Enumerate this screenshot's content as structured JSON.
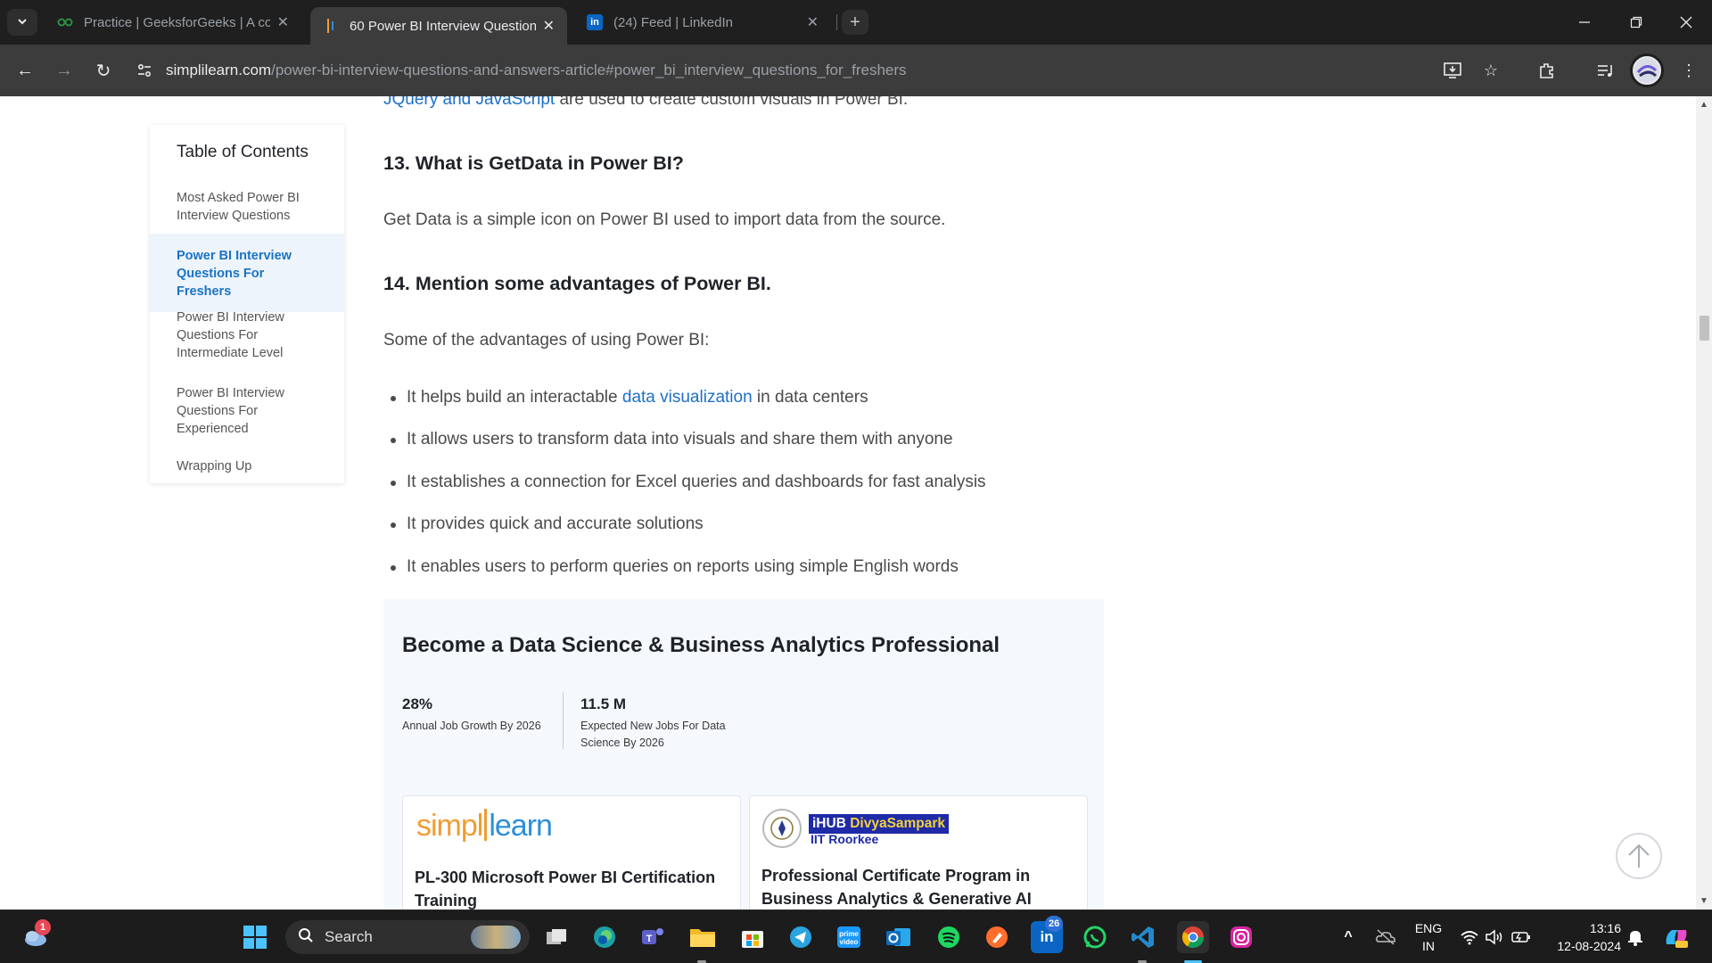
{
  "browser": {
    "tabs": [
      {
        "title": "Practice | GeeksforGeeks | A cor",
        "favicon": "gfg-icon",
        "active": false
      },
      {
        "title": "60 Power BI Interview Question",
        "favicon": "simplilearn-icon",
        "active": true
      },
      {
        "title": "(24) Feed | LinkedIn",
        "favicon": "linkedin-icon",
        "active": false
      }
    ],
    "url_host": "simplilearn.com",
    "url_path": "/power-bi-interview-questions-and-answers-article#power_bi_interview_questions_for_freshers"
  },
  "toc": {
    "title": "Table of Contents",
    "items": [
      {
        "label": "Most Asked Power BI Interview Questions",
        "active": false
      },
      {
        "label": "Power BI Interview Questions For Freshers",
        "active": true
      },
      {
        "label": "Power BI Interview Questions For Intermediate Level",
        "active": false
      },
      {
        "label": "Power BI Interview Questions For Experienced",
        "active": false
      },
      {
        "label": "Wrapping Up",
        "active": false
      }
    ]
  },
  "article": {
    "top_link": "JQuery and JavaScript",
    "top_rest": " are used to create custom visuals in Power BI.",
    "q13_heading": "13. What is GetData in Power BI?",
    "q13_answer": "Get Data is a simple icon on Power BI used to import data from the source.",
    "q14_heading": "14. Mention some advantages of Power BI.",
    "q14_intro": "Some of the advantages of using Power BI:",
    "bullets": [
      {
        "pre": "It helps build an interactable ",
        "link": "data visualization",
        "post": " in data centers"
      },
      {
        "pre": "It allows users to transform data into visuals and share them with anyone",
        "link": "",
        "post": ""
      },
      {
        "pre": "It establishes a connection for Excel queries and dashboards for fast analysis",
        "link": "",
        "post": ""
      },
      {
        "pre": "It provides quick and accurate solutions",
        "link": "",
        "post": ""
      },
      {
        "pre": "It enables users to perform queries on reports using simple English words",
        "link": "",
        "post": ""
      }
    ]
  },
  "promo": {
    "title": "Become a Data Science & Business Analytics Professional",
    "stats": [
      {
        "value": "28%",
        "label": "Annual Job Growth By 2026"
      },
      {
        "value": "11.5 M",
        "label": "Expected New Jobs For Data Science By 2026"
      }
    ],
    "cards": [
      {
        "logo": "simplilearn",
        "title": "PL-300 Microsoft Power BI Certification Training"
      },
      {
        "logo_badge_a": "iHUB ",
        "logo_badge_b": "DivyaSampark",
        "logo_sub": "IIT Roorkee",
        "title": "Professional Certificate Program in Business Analytics & Generative AI"
      }
    ]
  },
  "taskbar": {
    "weather_badge": "1",
    "search_label": "Search",
    "linkedin_badge": "26",
    "lang_line1": "ENG",
    "lang_line2": "IN",
    "time": "13:16",
    "date": "12-08-2024"
  },
  "colors": {
    "link": "#1d6fc9",
    "toc_active": "#1a73c8",
    "chrome_dark": "#1f1f1f"
  }
}
